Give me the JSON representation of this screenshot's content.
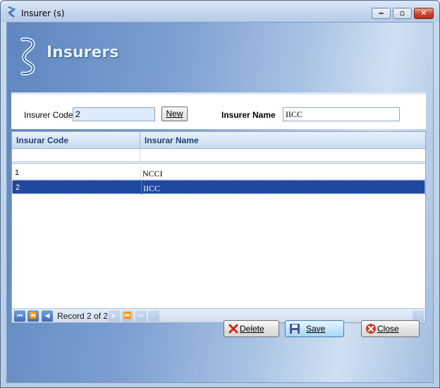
{
  "window": {
    "title": "Insurer (s)"
  },
  "header": {
    "title": "Insurers"
  },
  "form": {
    "code_label": "Insurer Code",
    "code_value": "2",
    "new_button": "New",
    "name_label": "Insurer Name",
    "name_value": "IICC"
  },
  "grid": {
    "columns": [
      "Insurar Code",
      "Insurar Name"
    ],
    "rows": [
      {
        "code": "1",
        "name": "NCCI"
      },
      {
        "code": "2",
        "name": "IICC"
      }
    ],
    "selected_row": 1,
    "navigator_text": "Record 2 of 2"
  },
  "actions": {
    "delete": "Delete",
    "save": "Save",
    "close": "Close"
  },
  "colors": {
    "selection": "#1f48a0",
    "header_text": "#1f3f73",
    "close_red": "#c8432c"
  }
}
